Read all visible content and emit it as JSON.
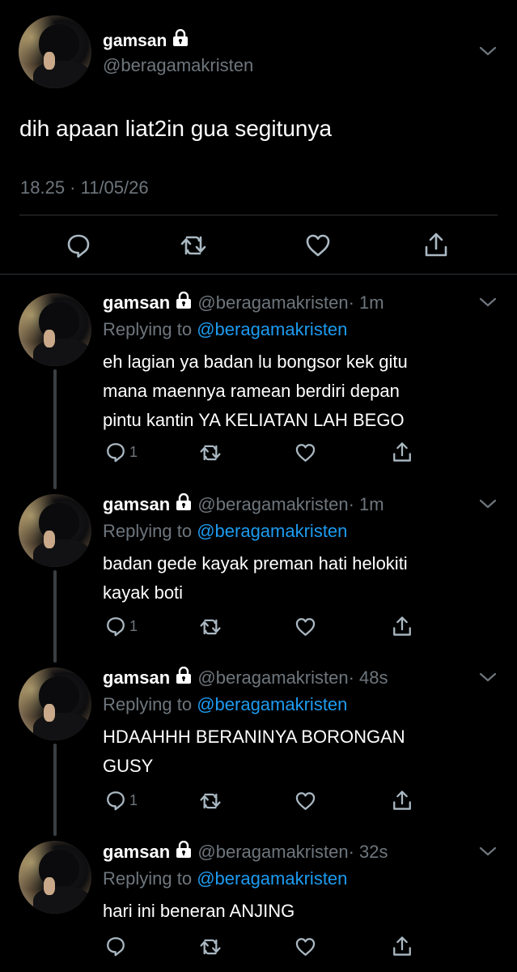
{
  "main_tweet": {
    "name": "gamsan",
    "handle": "@beragamakristen",
    "text": "dih apaan liat2in gua segitunya",
    "timestamp": "18.25 · 11/05/26"
  },
  "replies": [
    {
      "name": "gamsan",
      "handle": "@beragamakristen",
      "time": "· 1m",
      "replying_label": "Replying to",
      "replying_to": "@beragamakristen",
      "lines": [
        "eh lagian ya badan lu bongsor kek gitu",
        "mana maennya ramean berdiri depan",
        "pintu kantin YA KELIATAN LAH BEGO"
      ],
      "reply_count": "1"
    },
    {
      "name": "gamsan",
      "handle": "@beragamakristen",
      "time": "· 1m",
      "replying_label": "Replying to",
      "replying_to": "@beragamakristen",
      "lines": [
        "badan gede kayak preman hati helokiti",
        "kayak boti"
      ],
      "reply_count": "1"
    },
    {
      "name": "gamsan",
      "handle": "@beragamakristen",
      "time": "· 48s",
      "replying_label": "Replying to",
      "replying_to": "@beragamakristen",
      "lines": [
        "HDAAHHH BERANINYA BORONGAN",
        "GUSY"
      ],
      "reply_count": "1"
    },
    {
      "name": "gamsan",
      "handle": "@beragamakristen",
      "time": "· 32s",
      "replying_label": "Replying to",
      "replying_to": "@beragamakristen",
      "lines": [
        "hari ini beneran ANJING"
      ],
      "reply_count": ""
    }
  ],
  "icons": {
    "reply": "reply-icon",
    "retweet": "retweet-icon",
    "like": "heart-icon",
    "share": "share-icon",
    "lock": "lock-icon",
    "more": "chevron-down-icon"
  },
  "colors": {
    "background": "#000000",
    "text": "#ffffff",
    "muted": "#6e767d",
    "link": "#1d9bf0",
    "divider": "#2f3336"
  }
}
